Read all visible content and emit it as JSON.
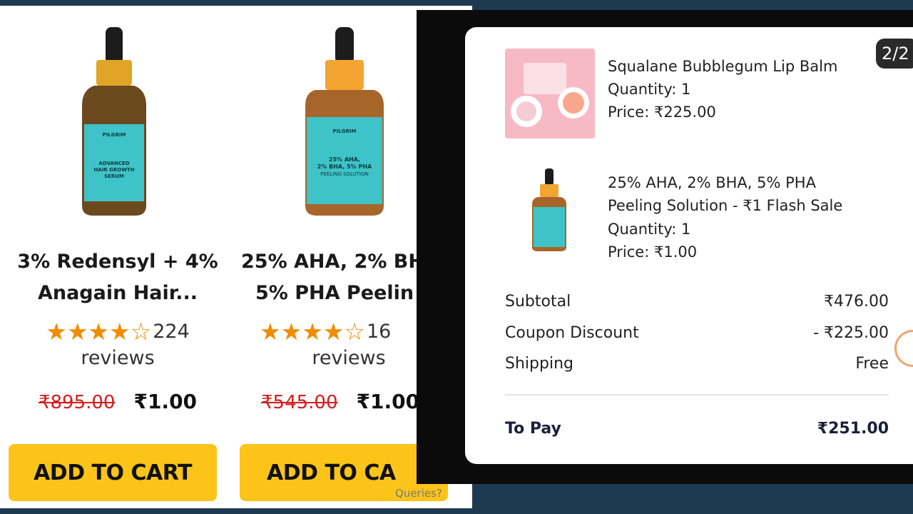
{
  "products": [
    {
      "title_line1": "3% Redensyl + 4%",
      "title_line2": "Anagain Hair...",
      "rating": 4,
      "rating_max": 5,
      "review_count": "224",
      "reviews_label": "reviews",
      "price_old": "₹895.00",
      "price_new": "₹1.00",
      "cart_label": "ADD TO CART",
      "image_brand": "PILGRIM",
      "image_text": "ADVANCED HAIR GROWTH SERUM",
      "image_label_color": "#3ec3c8",
      "image_bottle_color": "#6b4a1f",
      "image_collar_color": "#e0a526"
    },
    {
      "title_line1": "25% AHA, 2% BH",
      "title_line2": "5% PHA Peelin",
      "rating": 4,
      "rating_max": 5,
      "review_count": "16",
      "reviews_label": "reviews",
      "price_old": "₹545.00",
      "price_new": "₹1.00",
      "cart_label": "ADD TO CA",
      "image_brand": "PILGRIM",
      "image_text": "25% AHA, 2% BHA, 5% PHA PEELING SOLUTION",
      "image_label_color": "#3ec3c8",
      "image_bottle_color": "#a8652a",
      "image_collar_color": "#f2a530"
    }
  ],
  "queries_label": "Queries?",
  "order_summary": {
    "page_indicator": "2/2",
    "items": [
      {
        "name": "Squalane Bubblegum Lip Balm",
        "quantity": "Quantity: 1",
        "price": "Price: ₹225.00",
        "thumb_color": "#f7b9c4"
      },
      {
        "name_line1": "25% AHA, 2% BHA, 5% PHA",
        "name_line2": "Peeling Solution - ₹1 Flash Sale",
        "quantity": "Quantity: 1",
        "price": "Price: ₹1.00",
        "thumb_color": "#3ec3c8"
      }
    ],
    "subtotal_label": "Subtotal",
    "subtotal_value": "₹476.00",
    "coupon_label": "Coupon Discount",
    "coupon_value": "- ₹225.00",
    "shipping_label": "Shipping",
    "shipping_value": "Free",
    "to_pay_label": "To Pay",
    "to_pay_value": "₹251.00"
  },
  "colors": {
    "cart_button": "#fcc419",
    "star": "#f08c00",
    "strike_price": "#d32020",
    "background": "#1e3a52"
  }
}
